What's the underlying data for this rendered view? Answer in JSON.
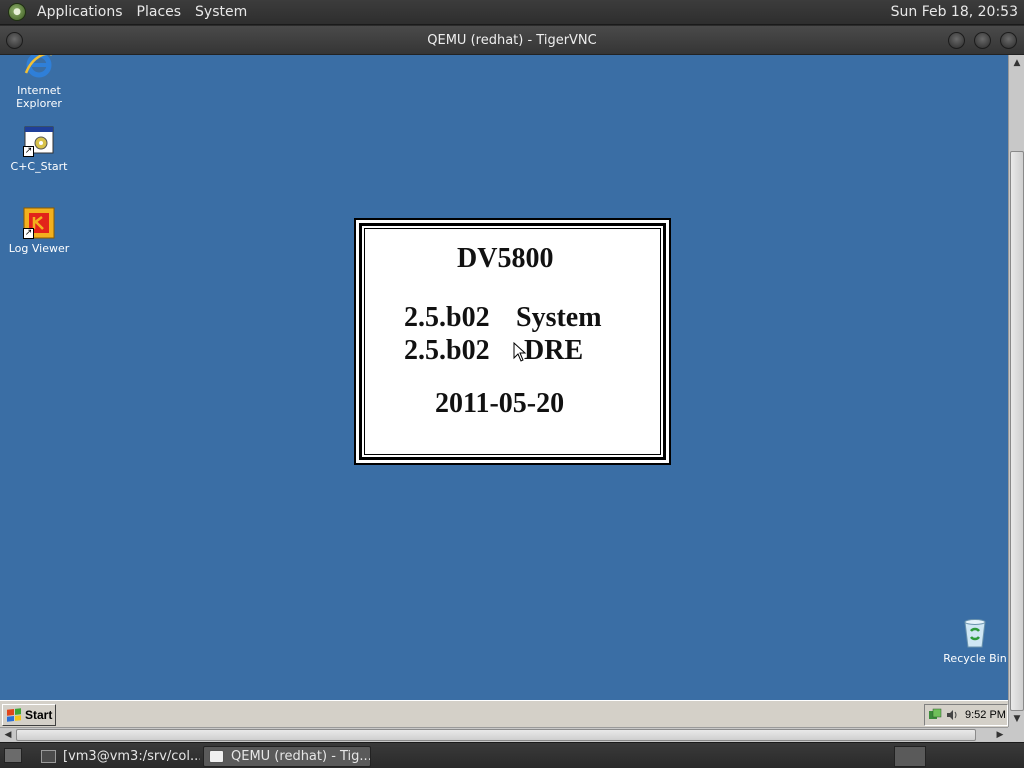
{
  "top_panel": {
    "menus": [
      "Applications",
      "Places",
      "System"
    ],
    "clock": "Sun Feb 18, 20:53"
  },
  "vnc_window": {
    "title": "QEMU (redhat) - TigerVNC"
  },
  "desktop": {
    "background_color": "#3a6ea5",
    "icons": [
      {
        "label_line1": "Internet",
        "label_line2": "Explorer",
        "icon": "internet-explorer-icon"
      },
      {
        "label": "C+C_Start",
        "icon": "program-shortcut-icon"
      },
      {
        "label": "Log Viewer",
        "icon": "kodak-log-viewer-icon"
      },
      {
        "label": "Recycle Bin",
        "icon": "recycle-bin-icon"
      }
    ],
    "splash": {
      "model": "DV5800",
      "line1_version": "2.5.b02",
      "line1_label": "System",
      "line2_version": "2.5.b02",
      "line2_label": "DRE",
      "date": "2011-05-20"
    }
  },
  "xp_taskbar": {
    "start_label": "Start",
    "tray_time": "9:52 PM"
  },
  "bottom_panel": {
    "tasks": [
      {
        "label": "[vm3@vm3:/srv/col...",
        "icon": "terminal-icon"
      },
      {
        "label": "QEMU (redhat) - Tig...",
        "icon": "vnc-viewer-icon",
        "active": true
      }
    ]
  }
}
